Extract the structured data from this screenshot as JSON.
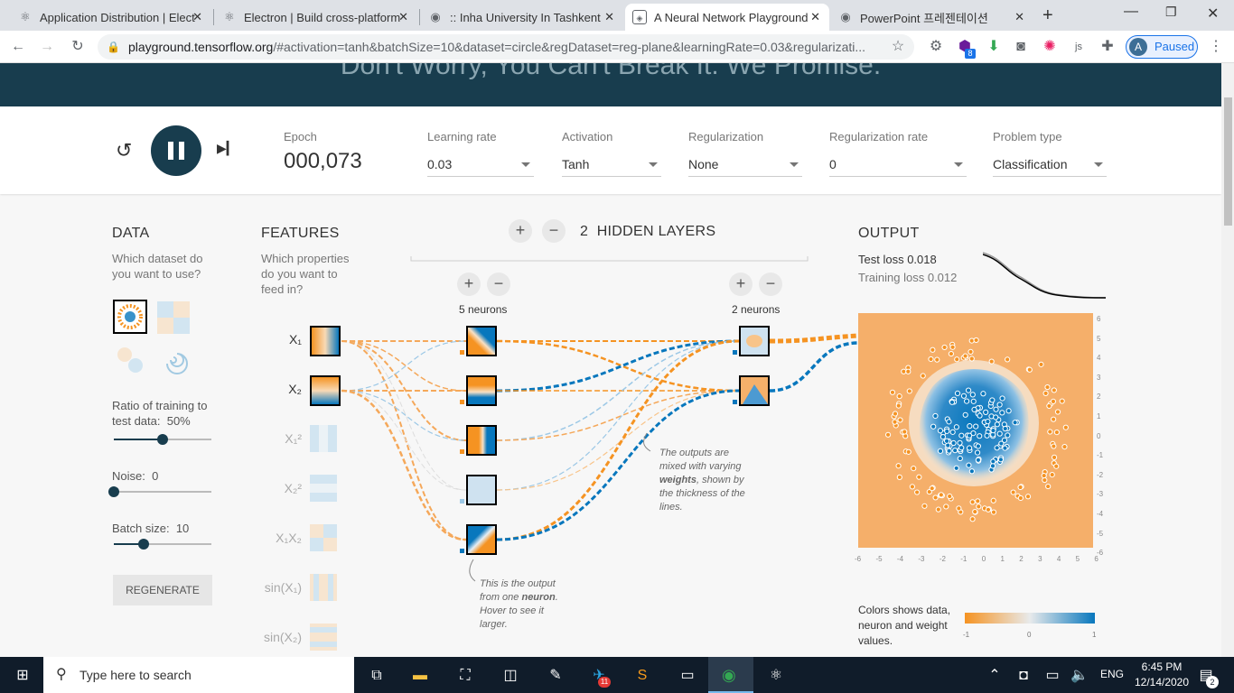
{
  "browser": {
    "tabs": [
      {
        "title": "Application Distribution | Elect",
        "icon": "electron-icon"
      },
      {
        "title": "Electron | Build cross-platform",
        "icon": "electron-icon"
      },
      {
        "title": ":: Inha University In Tashkent",
        "icon": "globe-icon"
      },
      {
        "title": "A Neural Network Playground",
        "icon": "tensorflow-icon"
      },
      {
        "title": "PowerPoint 프레젠테이션",
        "icon": "globe-icon"
      }
    ],
    "url_host": "playground.tensorflow.org",
    "url_rest": "/#activation=tanh&batchSize=10&dataset=circle&regDataset=reg-plane&learningRate=0.03&regularizati...",
    "profile_initial": "A",
    "profile_status": "Paused",
    "extension_badge": "8"
  },
  "banner": {
    "text": "Don't Worry, You Can't Break It. We Promise."
  },
  "controls": {
    "epoch_label": "Epoch",
    "epoch_value": "000,073",
    "learning_rate_label": "Learning rate",
    "learning_rate_value": "0.03",
    "activation_label": "Activation",
    "activation_value": "Tanh",
    "regularization_label": "Regularization",
    "regularization_value": "None",
    "reg_rate_label": "Regularization rate",
    "reg_rate_value": "0",
    "problem_label": "Problem type",
    "problem_value": "Classification"
  },
  "data_panel": {
    "heading": "DATA",
    "question": "Which dataset do you want to use?",
    "ratio_label": "Ratio of training to test data:",
    "ratio_value": "50%",
    "ratio_level": 0.5,
    "noise_label": "Noise:",
    "noise_value": "0",
    "noise_level": 0,
    "batch_label": "Batch size:",
    "batch_value": "10",
    "batch_level": 0.3,
    "regenerate": "REGENERATE"
  },
  "features": {
    "heading": "FEATURES",
    "question": "Which properties do you want to feed in?",
    "items": [
      {
        "label": "X₁",
        "active": true
      },
      {
        "label": "X₂",
        "active": true
      },
      {
        "label": "X₁²",
        "active": false
      },
      {
        "label": "X₂²",
        "active": false
      },
      {
        "label": "X₁X₂",
        "active": false
      },
      {
        "label": "sin(X₁)",
        "active": false
      },
      {
        "label": "sin(X₂)",
        "active": false
      }
    ]
  },
  "network": {
    "hidden_count": "2",
    "hidden_label": "HIDDEN LAYERS",
    "layer1_neurons": "5 neurons",
    "layer2_neurons": "2 neurons",
    "note_weights_a": "The outputs are mixed with varying ",
    "note_weights_b": "weights",
    "note_weights_c": ", shown by the thickness of the lines.",
    "note_neuron_a": "This is the output from one ",
    "note_neuron_b": "neuron",
    "note_neuron_c": ". Hover to see it larger."
  },
  "output": {
    "heading": "OUTPUT",
    "test_loss_label": "Test loss",
    "test_loss_value": "0.018",
    "train_loss_label": "Training loss",
    "train_loss_value": "0.012",
    "y_ticks": [
      "6",
      "5",
      "4",
      "3",
      "2",
      "1",
      "0",
      "-1",
      "-2",
      "-3",
      "-4",
      "-5",
      "-6"
    ],
    "x_ticks": [
      "-6",
      "-5",
      "-4",
      "-3",
      "-2",
      "-1",
      "0",
      "1",
      "2",
      "3",
      "4",
      "5",
      "6"
    ],
    "colors_note": "Colors shows data, neuron and weight values.",
    "scale_ticks": [
      "-1",
      "0",
      "1"
    ],
    "color_negative": "#f59322",
    "color_positive": "#0877bd"
  },
  "taskbar": {
    "search_placeholder": "Type here to search",
    "language": "ENG",
    "time": "6:45 PM",
    "date": "12/14/2020",
    "notification_count": "2",
    "app_badge": "11"
  }
}
